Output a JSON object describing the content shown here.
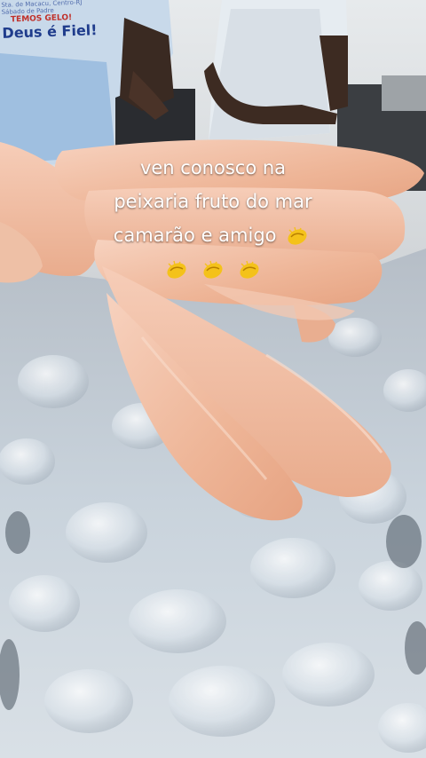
{
  "caption": {
    "line1": "ven conosco na",
    "line2": "peixaria fruto do mar",
    "line3": "camarão e amigo"
  },
  "emoji": {
    "icon": "clapping-hands-icon",
    "count": 4
  },
  "shirt": {
    "small1": "Sta. de Macacu, Centro-RJ",
    "small2": "Sábado de Padre",
    "badge": "TEMOS GELO!",
    "slogan": "Deus é Fiel!"
  },
  "colors": {
    "ice": "#c9d3dc",
    "fish": "#f2c0a8",
    "shirt": "#b9cfe6",
    "caption": "#ffffff"
  }
}
